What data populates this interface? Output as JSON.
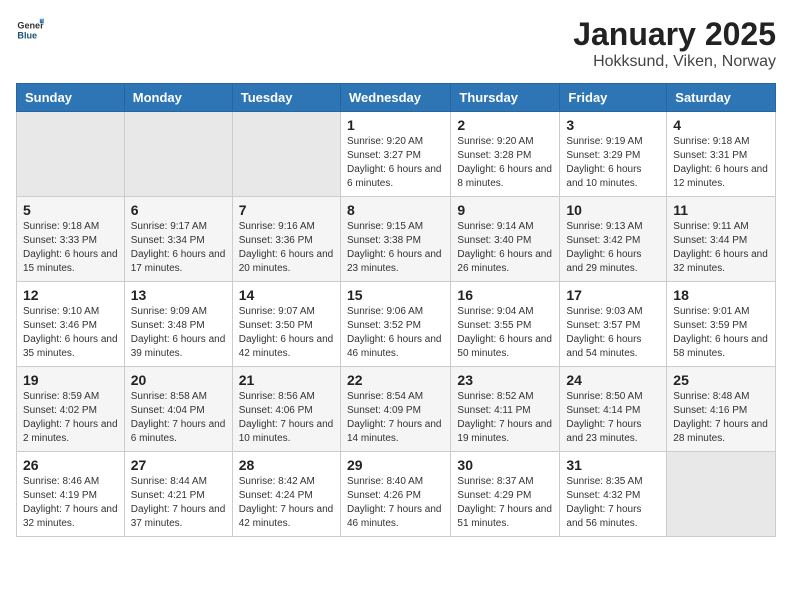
{
  "header": {
    "logo_general": "General",
    "logo_blue": "Blue",
    "title": "January 2025",
    "subtitle": "Hokksund, Viken, Norway"
  },
  "days_of_week": [
    "Sunday",
    "Monday",
    "Tuesday",
    "Wednesday",
    "Thursday",
    "Friday",
    "Saturday"
  ],
  "weeks": [
    [
      {
        "num": "",
        "info": ""
      },
      {
        "num": "",
        "info": ""
      },
      {
        "num": "",
        "info": ""
      },
      {
        "num": "1",
        "info": "Sunrise: 9:20 AM\nSunset: 3:27 PM\nDaylight: 6 hours and 6 minutes."
      },
      {
        "num": "2",
        "info": "Sunrise: 9:20 AM\nSunset: 3:28 PM\nDaylight: 6 hours and 8 minutes."
      },
      {
        "num": "3",
        "info": "Sunrise: 9:19 AM\nSunset: 3:29 PM\nDaylight: 6 hours and 10 minutes."
      },
      {
        "num": "4",
        "info": "Sunrise: 9:18 AM\nSunset: 3:31 PM\nDaylight: 6 hours and 12 minutes."
      }
    ],
    [
      {
        "num": "5",
        "info": "Sunrise: 9:18 AM\nSunset: 3:33 PM\nDaylight: 6 hours and 15 minutes."
      },
      {
        "num": "6",
        "info": "Sunrise: 9:17 AM\nSunset: 3:34 PM\nDaylight: 6 hours and 17 minutes."
      },
      {
        "num": "7",
        "info": "Sunrise: 9:16 AM\nSunset: 3:36 PM\nDaylight: 6 hours and 20 minutes."
      },
      {
        "num": "8",
        "info": "Sunrise: 9:15 AM\nSunset: 3:38 PM\nDaylight: 6 hours and 23 minutes."
      },
      {
        "num": "9",
        "info": "Sunrise: 9:14 AM\nSunset: 3:40 PM\nDaylight: 6 hours and 26 minutes."
      },
      {
        "num": "10",
        "info": "Sunrise: 9:13 AM\nSunset: 3:42 PM\nDaylight: 6 hours and 29 minutes."
      },
      {
        "num": "11",
        "info": "Sunrise: 9:11 AM\nSunset: 3:44 PM\nDaylight: 6 hours and 32 minutes."
      }
    ],
    [
      {
        "num": "12",
        "info": "Sunrise: 9:10 AM\nSunset: 3:46 PM\nDaylight: 6 hours and 35 minutes."
      },
      {
        "num": "13",
        "info": "Sunrise: 9:09 AM\nSunset: 3:48 PM\nDaylight: 6 hours and 39 minutes."
      },
      {
        "num": "14",
        "info": "Sunrise: 9:07 AM\nSunset: 3:50 PM\nDaylight: 6 hours and 42 minutes."
      },
      {
        "num": "15",
        "info": "Sunrise: 9:06 AM\nSunset: 3:52 PM\nDaylight: 6 hours and 46 minutes."
      },
      {
        "num": "16",
        "info": "Sunrise: 9:04 AM\nSunset: 3:55 PM\nDaylight: 6 hours and 50 minutes."
      },
      {
        "num": "17",
        "info": "Sunrise: 9:03 AM\nSunset: 3:57 PM\nDaylight: 6 hours and 54 minutes."
      },
      {
        "num": "18",
        "info": "Sunrise: 9:01 AM\nSunset: 3:59 PM\nDaylight: 6 hours and 58 minutes."
      }
    ],
    [
      {
        "num": "19",
        "info": "Sunrise: 8:59 AM\nSunset: 4:02 PM\nDaylight: 7 hours and 2 minutes."
      },
      {
        "num": "20",
        "info": "Sunrise: 8:58 AM\nSunset: 4:04 PM\nDaylight: 7 hours and 6 minutes."
      },
      {
        "num": "21",
        "info": "Sunrise: 8:56 AM\nSunset: 4:06 PM\nDaylight: 7 hours and 10 minutes."
      },
      {
        "num": "22",
        "info": "Sunrise: 8:54 AM\nSunset: 4:09 PM\nDaylight: 7 hours and 14 minutes."
      },
      {
        "num": "23",
        "info": "Sunrise: 8:52 AM\nSunset: 4:11 PM\nDaylight: 7 hours and 19 minutes."
      },
      {
        "num": "24",
        "info": "Sunrise: 8:50 AM\nSunset: 4:14 PM\nDaylight: 7 hours and 23 minutes."
      },
      {
        "num": "25",
        "info": "Sunrise: 8:48 AM\nSunset: 4:16 PM\nDaylight: 7 hours and 28 minutes."
      }
    ],
    [
      {
        "num": "26",
        "info": "Sunrise: 8:46 AM\nSunset: 4:19 PM\nDaylight: 7 hours and 32 minutes."
      },
      {
        "num": "27",
        "info": "Sunrise: 8:44 AM\nSunset: 4:21 PM\nDaylight: 7 hours and 37 minutes."
      },
      {
        "num": "28",
        "info": "Sunrise: 8:42 AM\nSunset: 4:24 PM\nDaylight: 7 hours and 42 minutes."
      },
      {
        "num": "29",
        "info": "Sunrise: 8:40 AM\nSunset: 4:26 PM\nDaylight: 7 hours and 46 minutes."
      },
      {
        "num": "30",
        "info": "Sunrise: 8:37 AM\nSunset: 4:29 PM\nDaylight: 7 hours and 51 minutes."
      },
      {
        "num": "31",
        "info": "Sunrise: 8:35 AM\nSunset: 4:32 PM\nDaylight: 7 hours and 56 minutes."
      },
      {
        "num": "",
        "info": ""
      }
    ]
  ]
}
